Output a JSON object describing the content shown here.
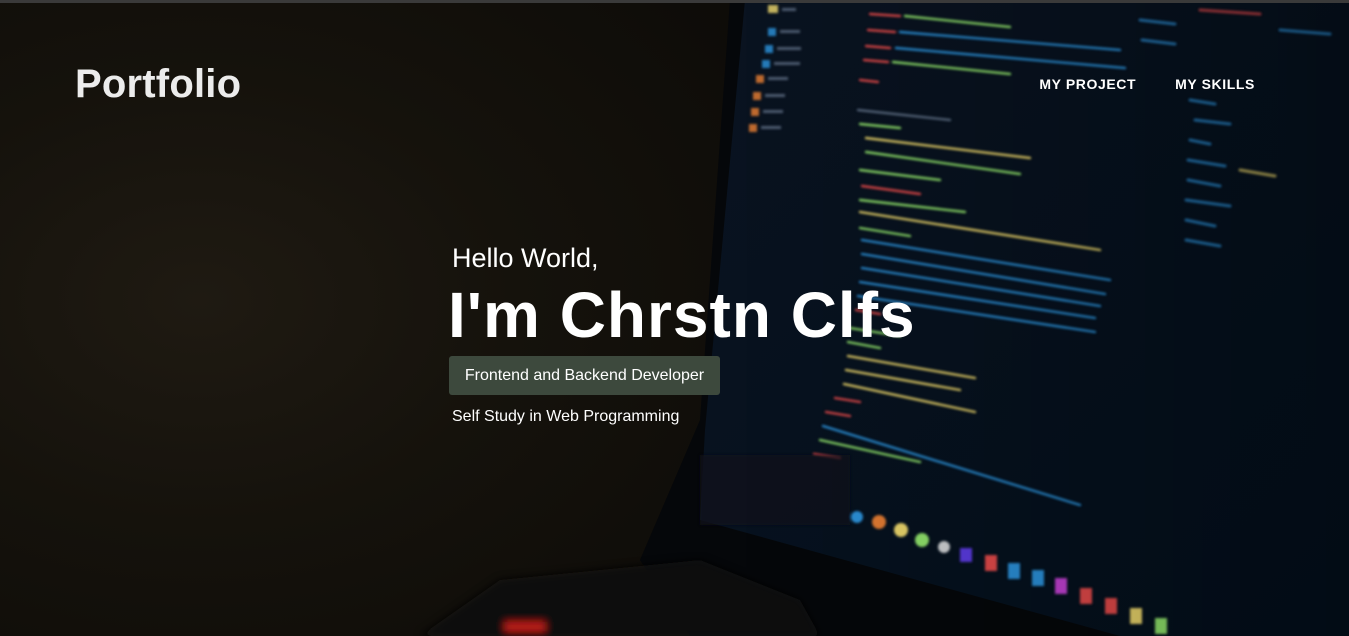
{
  "header": {
    "brand": "Portfolio",
    "nav": [
      {
        "label": "MY PROJECT"
      },
      {
        "label": "MY SKILLS"
      }
    ]
  },
  "hero": {
    "greeting": "Hello World,",
    "name": "I'm Chrstn Clfs",
    "role_button": "Frontend and Backend Developer",
    "tagline": "Self Study in Web Programming"
  },
  "background": {
    "description_icon": "laptop-code-screen-icon",
    "accent_code_blue": "#2b8fd6",
    "accent_code_green": "#8ee06a",
    "accent_code_red": "#e0484a",
    "accent_code_yellow": "#e8d36a"
  }
}
